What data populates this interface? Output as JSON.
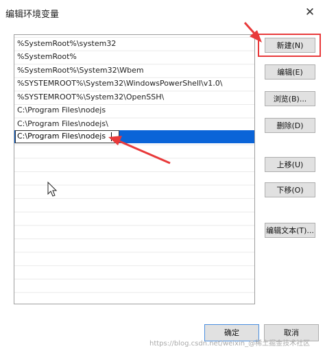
{
  "window": {
    "title": "编辑环境变量",
    "close_glyph": "✕"
  },
  "path_list": {
    "entries": [
      "%SystemRoot%\\system32",
      "%SystemRoot%",
      "%SystemRoot%\\System32\\Wbem",
      "%SYSTEMROOT%\\System32\\WindowsPowerShell\\v1.0\\",
      "%SYSTEMROOT%\\System32\\OpenSSH\\",
      "C:\\Program Files\\nodejs",
      "C:\\Program Files\\nodejs\\"
    ],
    "editing_entry": "C:\\Program Files\\nodejs"
  },
  "buttons": {
    "new": "新建(N)",
    "edit": "编辑(E)",
    "browse": "浏览(B)...",
    "delete": "删除(D)",
    "move_up": "上移(U)",
    "move_down": "下移(O)",
    "edit_text": "编辑文本(T)...",
    "ok": "确定",
    "cancel": "取消"
  },
  "annotation": {
    "color": "#e8393a"
  },
  "watermark": {
    "text": "https://blog.csdn.net/weixin_@稀土掘金技术社区"
  },
  "colors": {
    "selection": "#0a64d8",
    "button_face": "#e1e1e1",
    "default_button_border": "#4a8ee0"
  }
}
